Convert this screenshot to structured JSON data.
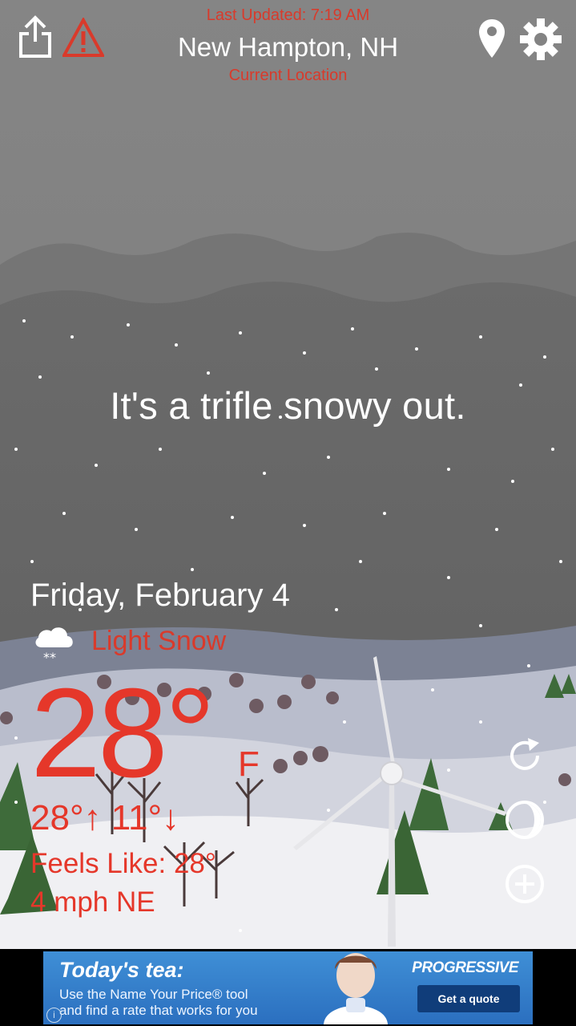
{
  "header": {
    "last_updated": "Last Updated: 7:19 AM",
    "location": "New Hampton, NH",
    "location_source": "Current Location"
  },
  "icons": {
    "share": "share-icon",
    "alert": "warning-icon",
    "location_pin": "map-pin-icon",
    "settings": "gear-icon",
    "refresh": "refresh-icon",
    "moon": "moon-phase-icon",
    "add": "add-icon",
    "condition": "snow-cloud-icon"
  },
  "weather": {
    "tagline": "It's a trifle snowy out.",
    "date": "Friday, February 4",
    "condition": "Light Snow",
    "temperature": "28°",
    "unit": "F",
    "hi_lo": "28°↑ 11°↓",
    "feels_like": "Feels Like: 28°",
    "wind": "4 mph NE"
  },
  "ad": {
    "headline": "Today's tea:",
    "body_line1": "Use the Name Your Price® tool",
    "body_line2": "and find a rate that works for you",
    "brand": "PROGRESSIVE",
    "cta": "Get a quote",
    "info": "i"
  },
  "colors": {
    "accent_red": "#e5372a",
    "sky": "#838383",
    "ad_blue": "#2b6fbf"
  }
}
